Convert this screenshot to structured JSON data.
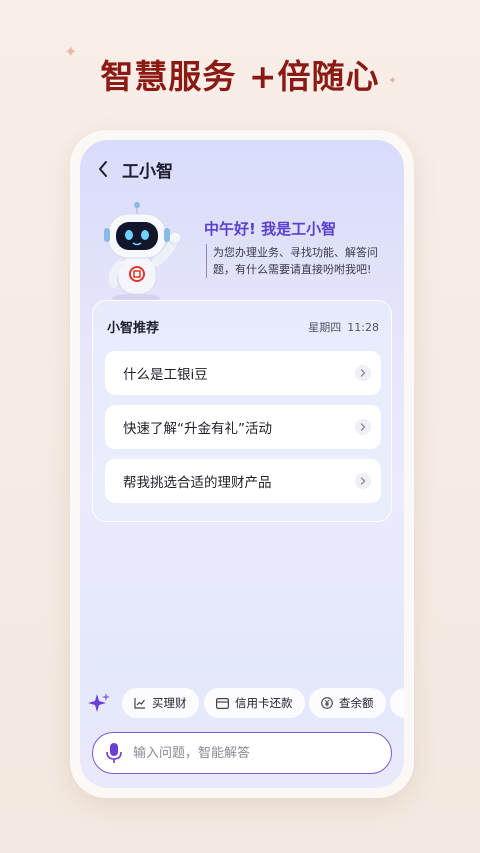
{
  "headline": "智慧服务 +倍随心",
  "header": {
    "title": "工小智"
  },
  "assistant": {
    "greeting": "中午好! 我是工小智",
    "intro": "为您办理业务、寻找功能、解答问题，有什么需要请直接吩咐我吧!"
  },
  "recommend": {
    "title": "小智推荐",
    "weekday": "星期四",
    "time": "11:28",
    "items": [
      {
        "label": "什么是工银i豆"
      },
      {
        "label": "快速了解“升金有礼”活动"
      },
      {
        "label": "帮我挑选合适的理财产品"
      }
    ]
  },
  "quick_actions": [
    {
      "label": "买理财",
      "icon": "chart-icon"
    },
    {
      "label": "信用卡还款",
      "icon": "card-icon"
    },
    {
      "label": "查余额",
      "icon": "yuan-icon"
    }
  ],
  "input": {
    "placeholder": "输入问题，智能解答"
  },
  "colors": {
    "headline": "#8c1a14",
    "accent": "#5b3fd1",
    "input_border": "#7a5bdb"
  }
}
